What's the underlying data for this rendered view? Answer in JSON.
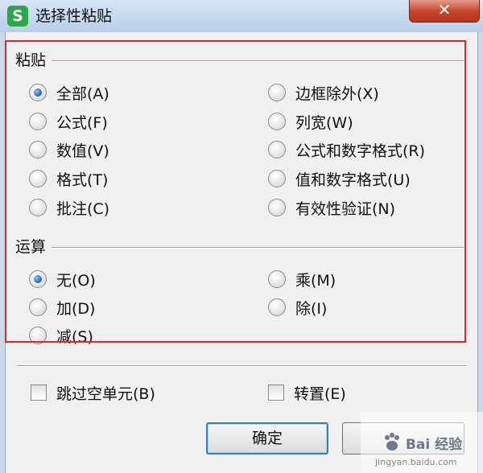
{
  "window": {
    "icon_letter": "S",
    "title": "选择性粘贴",
    "close_glyph": "✕"
  },
  "paste_group": {
    "label": "粘贴",
    "options": [
      {
        "label": "全部(A)",
        "selected": true
      },
      {
        "label": "公式(F)",
        "selected": false
      },
      {
        "label": "数值(V)",
        "selected": false
      },
      {
        "label": "格式(T)",
        "selected": false
      },
      {
        "label": "批注(C)",
        "selected": false
      },
      {
        "label": "边框除外(X)",
        "selected": false
      },
      {
        "label": "列宽(W)",
        "selected": false
      },
      {
        "label": "公式和数字格式(R)",
        "selected": false
      },
      {
        "label": "值和数字格式(U)",
        "selected": false
      },
      {
        "label": "有效性验证(N)",
        "selected": false
      }
    ]
  },
  "operation_group": {
    "label": "运算",
    "options": [
      {
        "label": "无(O)",
        "selected": true
      },
      {
        "label": "加(D)",
        "selected": false
      },
      {
        "label": "减(S)",
        "selected": false
      },
      {
        "label": "乘(M)",
        "selected": false
      },
      {
        "label": "除(I)",
        "selected": false
      }
    ]
  },
  "checkboxes": {
    "skip_blanks": {
      "label": "跳过空单元(B)",
      "checked": false
    },
    "transpose": {
      "label": "转置(E)",
      "checked": false
    }
  },
  "buttons": {
    "ok_label": "确定"
  },
  "watermark": {
    "text": "Bai 经验",
    "sub": "jingyan.baidu.com"
  },
  "colors": {
    "highlight_border": "#d9272e",
    "close_button": "#c9432b",
    "app_icon": "#2fa54a"
  }
}
